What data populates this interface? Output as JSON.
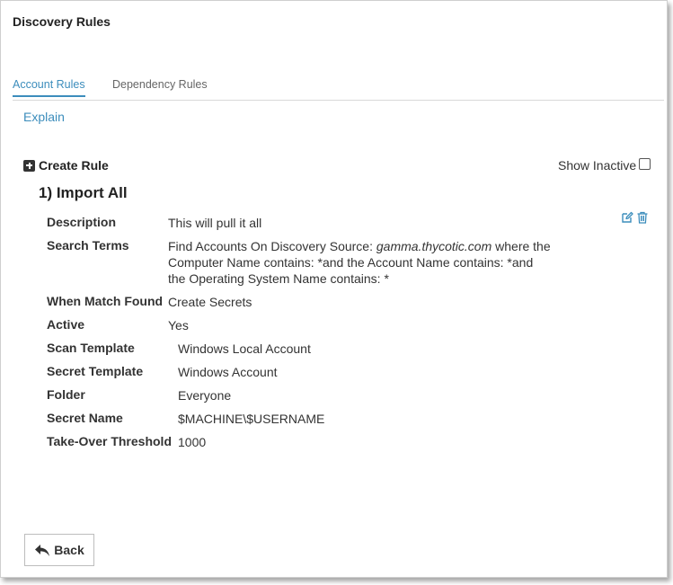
{
  "page": {
    "title": "Discovery Rules"
  },
  "tabs": [
    {
      "label": "Account Rules",
      "active": true
    },
    {
      "label": "Dependency Rules",
      "active": false
    }
  ],
  "explain_link": "Explain",
  "toolbar": {
    "create_rule_label": "Create Rule",
    "show_inactive_label": "Show Inactive",
    "show_inactive_checked": false
  },
  "rule": {
    "title": "1) Import All",
    "fields": {
      "description": {
        "label": "Description",
        "value": "This will pull it all"
      },
      "search_terms": {
        "label": "Search Terms",
        "line1_prefix": "Find Accounts On Discovery Source: ",
        "line1_source": "gamma.thycotic.com",
        "line1_suffix": " where the",
        "line2": "Computer Name contains: *and the Account Name contains: *and",
        "line3": "the Operating System Name contains: *"
      },
      "when_match_found": {
        "label": "When Match Found",
        "value": "Create Secrets"
      },
      "active": {
        "label": "Active",
        "value": "Yes"
      },
      "scan_template": {
        "label": "Scan Template",
        "value": "Windows Local Account"
      },
      "secret_template": {
        "label": "Secret Template",
        "value": "Windows Account"
      },
      "folder": {
        "label": "Folder",
        "value": "Everyone"
      },
      "secret_name": {
        "label": "Secret Name",
        "value": "$MACHINE\\$USERNAME"
      },
      "take_over_threshold": {
        "label": "Take-Over Threshold",
        "value": "1000"
      }
    }
  },
  "back_button_label": "Back",
  "icons": {
    "create": "plus-square-icon",
    "edit": "edit-icon",
    "delete": "trash-icon",
    "back": "reply-arrow-icon"
  },
  "colors": {
    "accent": "#3c8dbc",
    "text": "#333333"
  }
}
